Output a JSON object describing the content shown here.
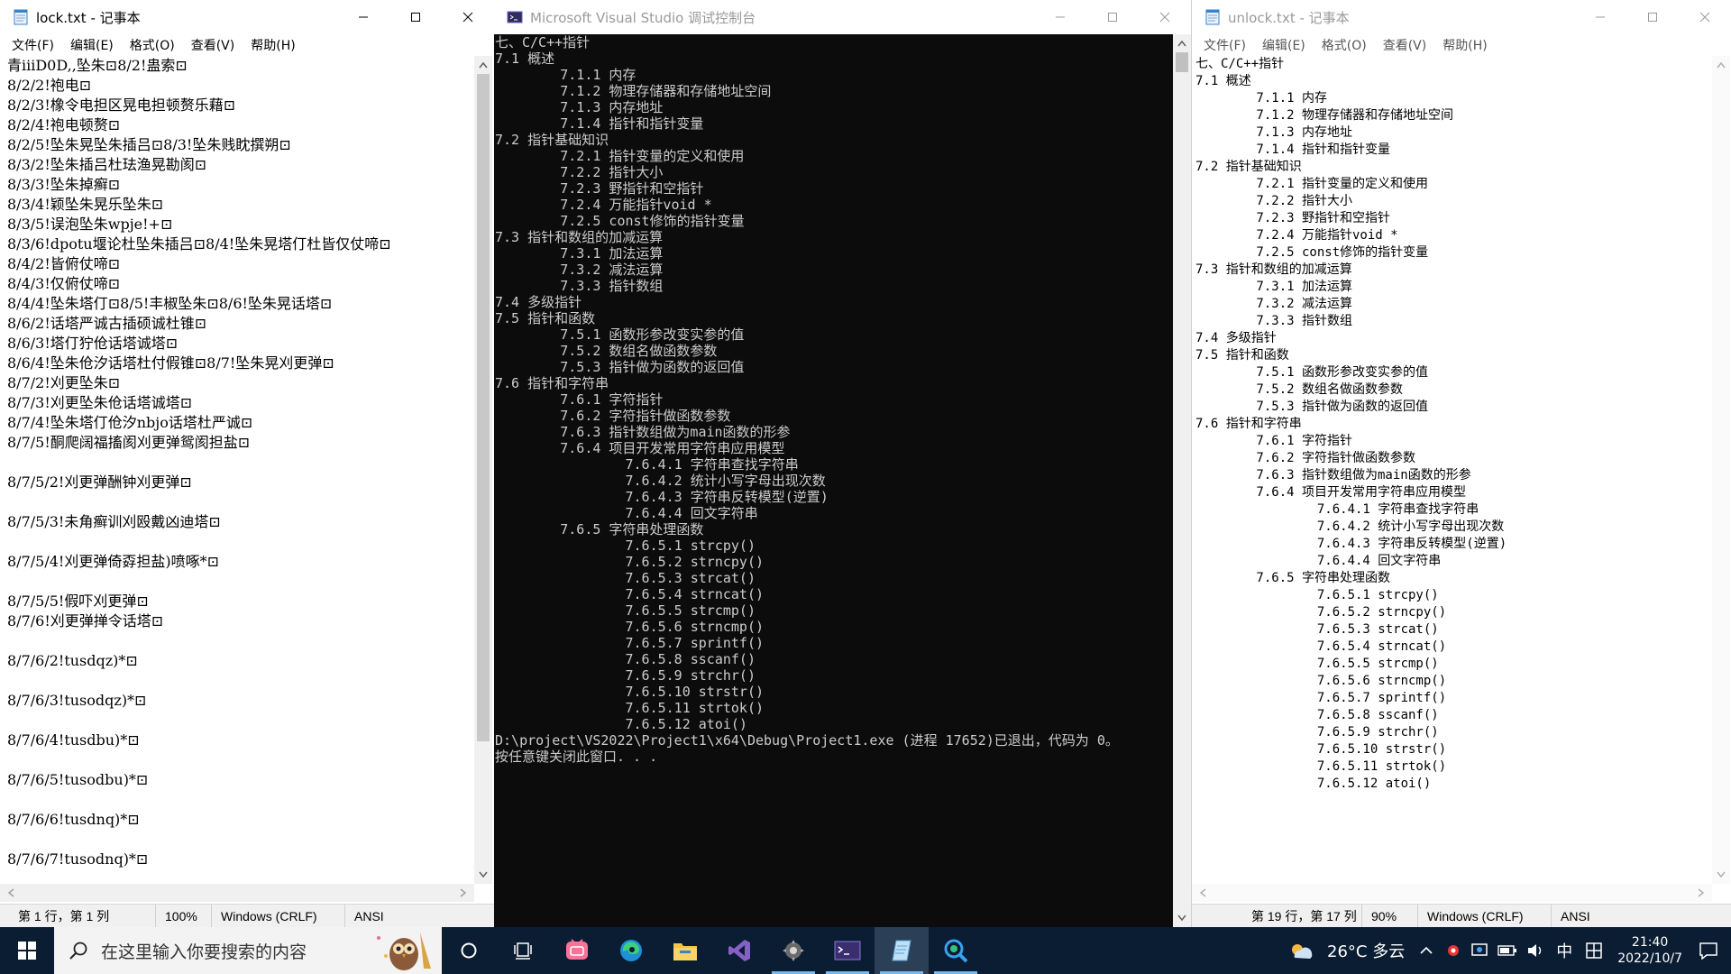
{
  "left_notepad": {
    "title": "lock.txt - 记事本",
    "menu": [
      "文件(F)",
      "编辑(E)",
      "格式(O)",
      "查看(V)",
      "帮助(H)"
    ],
    "lines": [
      "青iiiD0D,,坠朱⊡8/2!蛊索⊡",
      "8/2/2!袍电⊡",
      "8/2/3!橡令电担区晃电担顿赘乐藉⊡",
      "8/2/4!袍电顿赘⊡",
      "8/2/5!坠朱晃坠朱插吕⊡8/3!坠朱贱眈撰朔⊡",
      "8/3/2!坠朱插吕杜珐渔晃勘阂⊡",
      "8/3/3!坠朱掉癣⊡",
      "8/3/4!颖坠朱晃乐坠朱⊡",
      "8/3/5!误泡坠朱wpje!+⊡",
      "8/3/6!dpotu堰论杜坠朱插吕⊡8/4!坠朱晃塔仃杜皆仅仗啼⊡",
      "8/4/2!皆俯仗啼⊡",
      "8/4/3!仅俯仗啼⊡",
      "8/4/4!坠朱塔仃⊡8/5!丰椒坠朱⊡8/6!坠朱晃话塔⊡",
      "8/6/2!话塔严诚古插硕诚杜锥⊡",
      "8/6/3!塔仃狞伧话塔诚塔⊡",
      "8/6/4!坠朱伧汐话塔杜付假锥⊡8/7!坠朱晃刈更弹⊡",
      "8/7/2!刈更坠朱⊡",
      "8/7/3!刈更坠朱伧话塔诚塔⊡",
      "8/7/4!坠朱塔仃伧汐nbjo话塔杜严诚⊡",
      "8/7/5!酮爬阔福搐阂刈更弹鸳阂担盐⊡",
      "",
      "8/7/5/2!刈更弹酬钟刈更弹⊡",
      "",
      "8/7/5/3!未角癣训刈殴戴凶迪塔⊡",
      "",
      "8/7/5/4!刈更弹倚孬担盐)喷啄*⊡",
      "",
      "8/7/5/5!假吓刈更弹⊡",
      "8/7/6!刈更弹掸令话塔⊡",
      "",
      "8/7/6/2!tusdqz)*⊡",
      "",
      "8/7/6/3!tusodqz)*⊡",
      "",
      "8/7/6/4!tusdbu)*⊡",
      "",
      "8/7/6/5!tusodbu)*⊡",
      "",
      "8/7/6/6!tusdnq)*⊡",
      "",
      "8/7/6/7!tusodnq)*⊡"
    ],
    "status": {
      "position": "第 1 行，第 1 列",
      "zoom": "100%",
      "eol": "Windows (CRLF)",
      "encoding": "ANSI"
    }
  },
  "console": {
    "title": "Microsoft Visual Studio 调试控制台",
    "lines": [
      "七、C/C++指针",
      "7.1 概述",
      "        7.1.1 内存",
      "        7.1.2 物理存储器和存储地址空间",
      "        7.1.3 内存地址",
      "        7.1.4 指针和指针变量",
      "7.2 指针基础知识",
      "        7.2.1 指针变量的定义和使用",
      "        7.2.2 指针大小",
      "        7.2.3 野指针和空指针",
      "        7.2.4 万能指针void *",
      "        7.2.5 const修饰的指针变量",
      "7.3 指针和数组的加减运算",
      "        7.3.1 加法运算",
      "        7.3.2 减法运算",
      "        7.3.3 指针数组",
      "7.4 多级指针",
      "7.5 指针和函数",
      "        7.5.1 函数形参改变实参的值",
      "        7.5.2 数组名做函数参数",
      "        7.5.3 指针做为函数的返回值",
      "7.6 指针和字符串",
      "        7.6.1 字符指针",
      "        7.6.2 字符指针做函数参数",
      "        7.6.3 指针数组做为main函数的形参",
      "        7.6.4 项目开发常用字符串应用模型",
      "                7.6.4.1 字符串查找字符串",
      "                7.6.4.2 统计小写字母出现次数",
      "                7.6.4.3 字符串反转模型(逆置)",
      "                7.6.4.4 回文字符串",
      "        7.6.5 字符串处理函数",
      "                7.6.5.1 strcpy()",
      "                7.6.5.2 strncpy()",
      "                7.6.5.3 strcat()",
      "                7.6.5.4 strncat()",
      "                7.6.5.5 strcmp()",
      "                7.6.5.6 strncmp()",
      "                7.6.5.7 sprintf()",
      "                7.6.5.8 sscanf()",
      "                7.6.5.9 strchr()",
      "                7.6.5.10 strstr()",
      "                7.6.5.11 strtok()",
      "                7.6.5.12 atoi()",
      "D:\\project\\VS2022\\Project1\\x64\\Debug\\Project1.exe (进程 17652)已退出，代码为 0。",
      "按任意键关闭此窗口. . ."
    ]
  },
  "right_notepad": {
    "title": "unlock.txt - 记事本",
    "menu": [
      "文件(F)",
      "编辑(E)",
      "格式(O)",
      "查看(V)",
      "帮助(H)"
    ],
    "lines": [
      "七、C/C++指针",
      "7.1 概述",
      "        7.1.1 内存",
      "        7.1.2 物理存储器和存储地址空间",
      "        7.1.3 内存地址",
      "        7.1.4 指针和指针变量",
      "7.2 指针基础知识",
      "        7.2.1 指针变量的定义和使用",
      "        7.2.2 指针大小",
      "        7.2.3 野指针和空指针",
      "        7.2.4 万能指针void *",
      "        7.2.5 const修饰的指针变量",
      "7.3 指针和数组的加减运算",
      "        7.3.1 加法运算",
      "        7.3.2 减法运算",
      "        7.3.3 指针数组",
      "7.4 多级指针",
      "7.5 指针和函数",
      "        7.5.1 函数形参改变实参的值",
      "        7.5.2 数组名做函数参数",
      "        7.5.3 指针做为函数的返回值",
      "7.6 指针和字符串",
      "        7.6.1 字符指针",
      "        7.6.2 字符指针做函数参数",
      "        7.6.3 指针数组做为main函数的形参",
      "        7.6.4 项目开发常用字符串应用模型",
      "                7.6.4.1 字符串查找字符串",
      "                7.6.4.2 统计小写字母出现次数",
      "                7.6.4.3 字符串反转模型(逆置)",
      "                7.6.4.4 回文字符串",
      "        7.6.5 字符串处理函数",
      "                7.6.5.1 strcpy()",
      "                7.6.5.2 strncpy()",
      "                7.6.5.3 strcat()",
      "                7.6.5.4 strncat()",
      "                7.6.5.5 strcmp()",
      "                7.6.5.6 strncmp()",
      "                7.6.5.7 sprintf()",
      "                7.6.5.8 sscanf()",
      "                7.6.5.9 strchr()",
      "                7.6.5.10 strstr()",
      "                7.6.5.11 strtok()",
      "                7.6.5.12 atoi()"
    ],
    "status": {
      "position": "第 19 行，第 17 列",
      "zoom": "90%",
      "eol": "Windows (CRLF)",
      "encoding": "ANSI"
    }
  },
  "taskbar": {
    "search_placeholder": "在这里输入你要搜索的内容",
    "weather": "26°C 多云",
    "ime": "中",
    "time": "21:40",
    "date": "2022/10/7"
  }
}
